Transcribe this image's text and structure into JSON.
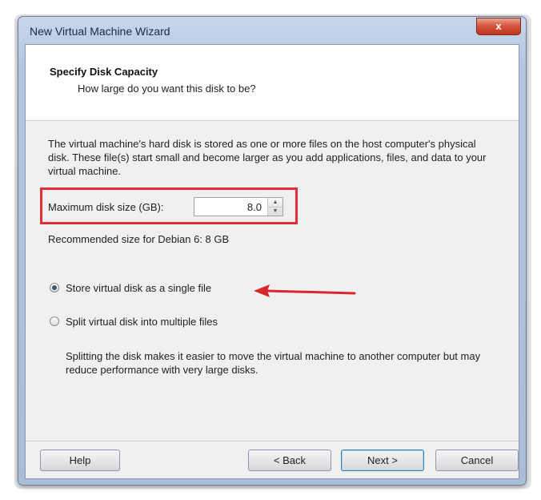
{
  "window": {
    "title": "New Virtual Machine Wizard",
    "close_glyph": "x"
  },
  "header": {
    "title": "Specify Disk Capacity",
    "subtitle": "How large do you want this disk to be?"
  },
  "description": "The virtual machine's hard disk is stored as one or more files on the host computer's physical disk. These file(s) start small and become larger as you add applications, files, and data to your virtual machine.",
  "disk_size": {
    "label": "Maximum disk size (GB):",
    "value": "8.0"
  },
  "recommended": "Recommended size for Debian 6: 8 GB",
  "options": [
    {
      "label": "Store virtual disk as a single file",
      "selected": true
    },
    {
      "label": "Split virtual disk into multiple files",
      "selected": false
    }
  ],
  "split_note": "Splitting the disk makes it easier to move the virtual machine to another computer but may reduce performance with very large disks.",
  "buttons": {
    "help": "Help",
    "back": "< Back",
    "next": "Next >",
    "cancel": "Cancel"
  },
  "colors": {
    "highlight": "#e0303a",
    "arrow": "#d8262e"
  }
}
